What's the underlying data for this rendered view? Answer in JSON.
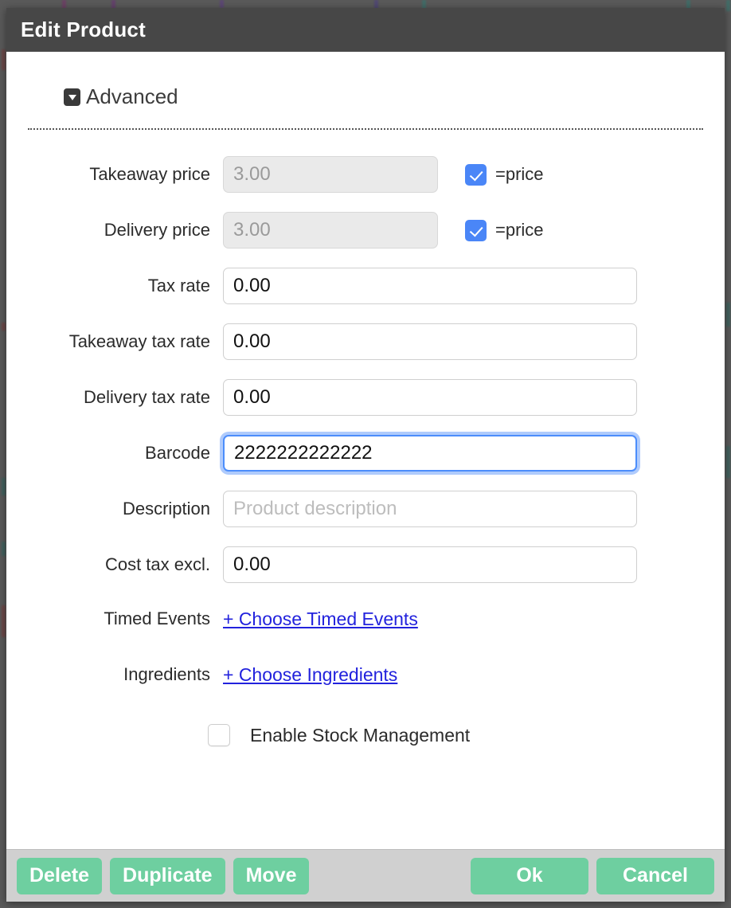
{
  "dialog": {
    "title": "Edit Product"
  },
  "section": {
    "disclosure_icon": "caret-down-icon",
    "title": "Advanced"
  },
  "form": {
    "rows": [
      {
        "label": "Takeaway price",
        "value": "3.00",
        "disabled": true,
        "checkbox": {
          "label": "=price",
          "checked": true
        }
      },
      {
        "label": "Delivery price",
        "value": "3.00",
        "disabled": true,
        "checkbox": {
          "label": "=price",
          "checked": true
        }
      },
      {
        "label": "Tax rate",
        "value": "0.00"
      },
      {
        "label": "Takeaway tax rate",
        "value": "0.00"
      },
      {
        "label": "Delivery tax rate",
        "value": "0.00"
      },
      {
        "label": "Barcode",
        "value": "2222222222222",
        "focused": true
      },
      {
        "label": "Description",
        "value": "",
        "placeholder": "Product description"
      },
      {
        "label": "Cost tax excl.",
        "value": "0.00"
      }
    ],
    "links": [
      {
        "label": "Timed Events",
        "link_text": "+ Choose Timed Events"
      },
      {
        "label": "Ingredients",
        "link_text": "+ Choose Ingredients"
      }
    ],
    "stock": {
      "label": "Enable Stock Management",
      "checked": false
    }
  },
  "footer": {
    "delete_label": "Delete",
    "duplicate_label": "Duplicate",
    "move_label": "Move",
    "ok_label": "Ok",
    "cancel_label": "Cancel"
  },
  "colors": {
    "titlebar": "#474747",
    "button_green": "#6ecfa0",
    "checkbox_blue": "#4a86f7",
    "link_blue": "#2222dd",
    "focus_ring": "#4c8dfb",
    "footer_bg": "#d0d0d0"
  }
}
